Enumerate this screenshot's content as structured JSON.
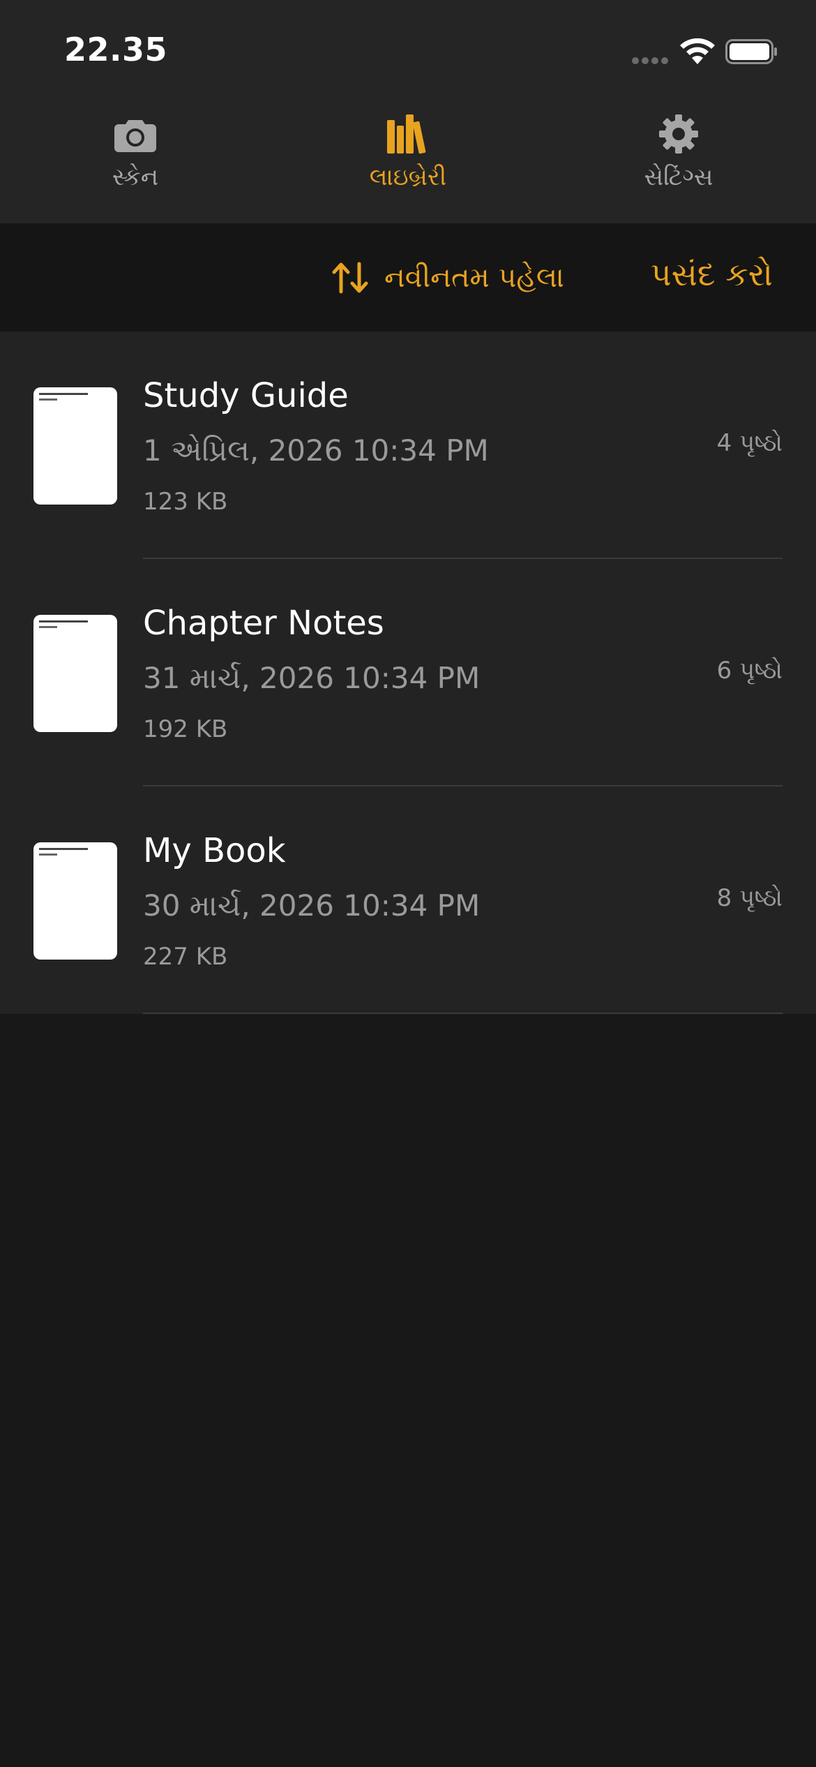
{
  "status_bar": {
    "time": "22.35"
  },
  "tabs": [
    {
      "label": "સ્કેન",
      "icon": "camera-icon",
      "active": false
    },
    {
      "label": "લાઇબ્રેરી",
      "icon": "library-books-icon",
      "active": true
    },
    {
      "label": "સેટિંગ્સ",
      "icon": "gear-icon",
      "active": false
    }
  ],
  "toolbar": {
    "sort_label": "નવીનતમ પહેલા",
    "sort_icon": "sort-arrows-icon",
    "select_label": "પસંદ કરો"
  },
  "documents": [
    {
      "title": "Study Guide",
      "date": "1 એપ્રિલ, 2026 10:34 PM",
      "size": "123 KB",
      "pages": "4 પૃષ્ઠો"
    },
    {
      "title": "Chapter Notes",
      "date": "31 માર્ચ, 2026 10:34 PM",
      "size": "192 KB",
      "pages": "6 પૃષ્ઠો"
    },
    {
      "title": "My Book",
      "date": "30 માર્ચ, 2026 10:34 PM",
      "size": "227 KB",
      "pages": "8 પૃષ્ઠો"
    }
  ],
  "colors": {
    "accent": "#e8a320",
    "background": "#181818",
    "header_background": "#252525",
    "list_background": "#232323",
    "secondary_text": "#9a9a9a"
  }
}
